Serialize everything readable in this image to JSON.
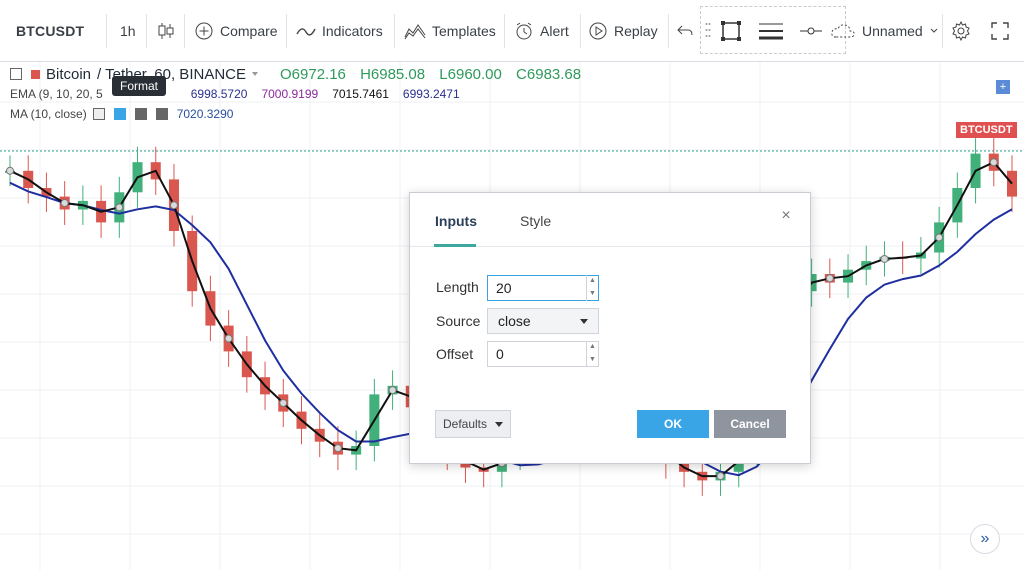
{
  "toolbar": {
    "symbol": "BTCUSDT",
    "interval": "1h",
    "compare_label": "Compare",
    "indicators_label": "Indicators",
    "templates_label": "Templates",
    "alert_label": "Alert",
    "replay_label": "Replay",
    "layout_name": "Unnamed"
  },
  "legend": {
    "title_a": "Bitcoin",
    "title_b": "/ Tether, 60, BINANCE",
    "open": "O6972.16",
    "high": "H6985.08",
    "low": "L6960.00",
    "close": "C6983.68",
    "ema_label": "EMA (9, 10, 20, 5",
    "ema_values": [
      "6998.5720",
      "7000.9199",
      "7015.7461",
      "6993.2471"
    ],
    "ma_label": "MA (10, close)",
    "ma_value": "7020.3290",
    "tooltip": "Format"
  },
  "chart": {
    "price_tag": "BTCUSDT",
    "colors": {
      "up": "#41b07a",
      "down": "#d9574f",
      "ma_blue": "#1f2fa0",
      "ma_black": "#111111",
      "hline": "#2aa08a"
    },
    "close_series": [
      7020,
      7000,
      6990,
      6975,
      6985,
      6960,
      6995,
      7030,
      7010,
      6950,
      6880,
      6840,
      6810,
      6780,
      6760,
      6740,
      6720,
      6705,
      6690,
      6700,
      6760,
      6770,
      6745,
      6715,
      6690,
      6675,
      6670,
      6690,
      6710,
      6720,
      6725,
      6730,
      6728,
      6735,
      6720,
      6705,
      6680,
      6670,
      6660,
      6670,
      6695,
      6765,
      6830,
      6880,
      6900,
      6890,
      6905,
      6915,
      6920,
      6918,
      6925,
      6960,
      7000,
      7040,
      7020,
      6990
    ]
  },
  "dialog": {
    "tab_inputs": "Inputs",
    "tab_style": "Style",
    "close_icon": "×",
    "length_label": "Length",
    "length_value": "20",
    "source_label": "Source",
    "source_value": "close",
    "offset_label": "Offset",
    "offset_value": "0",
    "defaults_label": "Defaults",
    "ok_label": "OK",
    "cancel_label": "Cancel"
  },
  "nav": {
    "scroll_icon": "»",
    "add_icon": "+"
  }
}
